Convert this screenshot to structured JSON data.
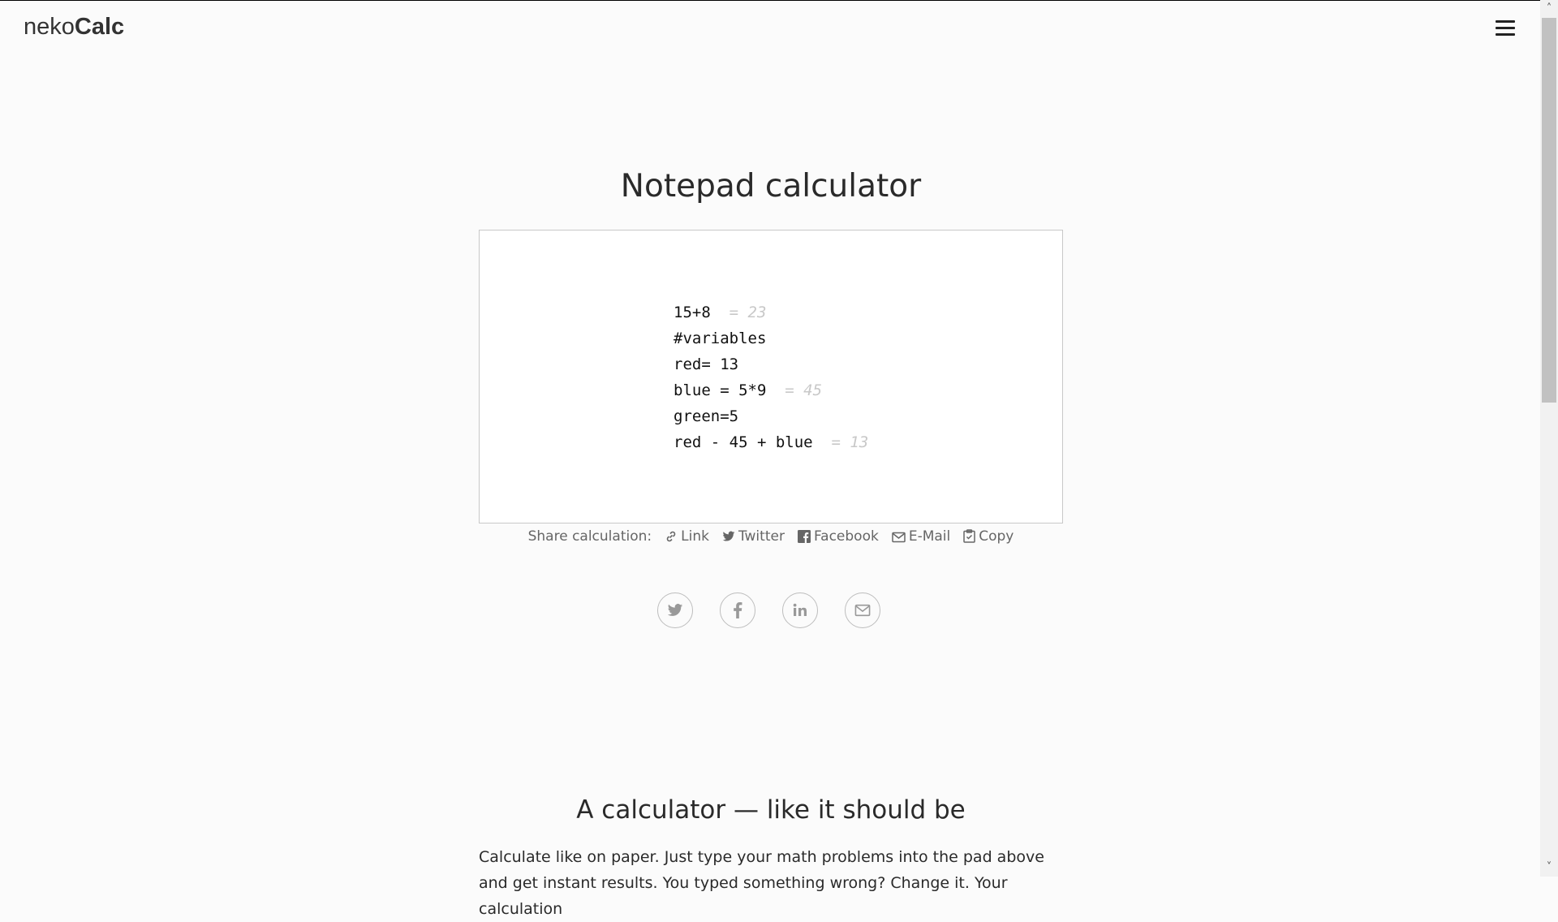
{
  "header": {
    "logo_light": "neko",
    "logo_bold": "Calc"
  },
  "page": {
    "title": "Notepad calculator"
  },
  "notepad": {
    "lines": [
      {
        "expression": "15+8",
        "result": "= 23"
      },
      {
        "expression": "#variables",
        "result": ""
      },
      {
        "expression": "red= 13",
        "result": ""
      },
      {
        "expression": "blue = 5*9",
        "result": "= 45"
      },
      {
        "expression": "green=5",
        "result": ""
      },
      {
        "expression": "red - 45 + blue",
        "result": "= 13"
      }
    ]
  },
  "share": {
    "label": "Share calculation:",
    "items": [
      {
        "label": "Link",
        "icon": "link-icon"
      },
      {
        "label": "Twitter",
        "icon": "twitter-icon"
      },
      {
        "label": "Facebook",
        "icon": "facebook-icon"
      },
      {
        "label": "E-Mail",
        "icon": "mail-icon"
      },
      {
        "label": "Copy",
        "icon": "clipboard-icon"
      }
    ]
  },
  "social_buttons": [
    "twitter-icon",
    "facebook-icon",
    "linkedin-icon",
    "mail-icon"
  ],
  "section": {
    "title": "A calculator — like it should be",
    "text": "Calculate like on paper. Just type your math problems into the pad above and get instant results. You typed something wrong? Change it. Your calculation"
  }
}
